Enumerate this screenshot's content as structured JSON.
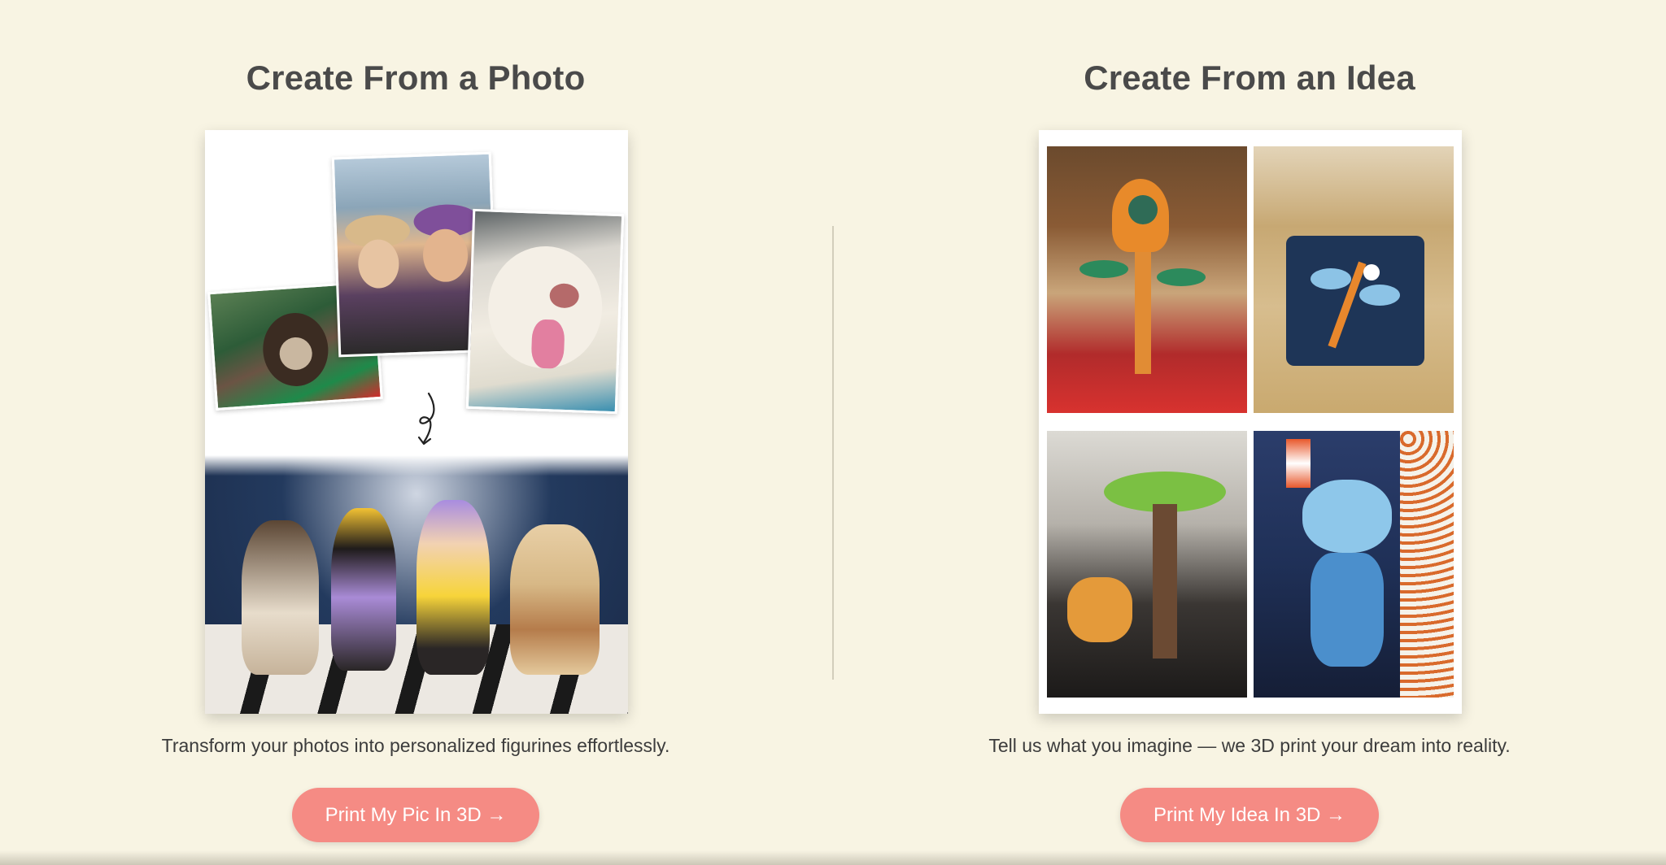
{
  "photo_section": {
    "title": "Create From a Photo",
    "description": "Transform your photos into personalized figurines effortlessly.",
    "cta_label": "Print My Pic In 3D →",
    "collage": {
      "source_photos": [
        "dog-photo",
        "couple-selfie-photo",
        "white-dog-photo"
      ],
      "result_image": "figurines-on-piano-photo",
      "arrow_icon": "curly-arrow-down-icon"
    }
  },
  "idea_section": {
    "title": "Create From an Idea",
    "description": "Tell us what you imagine — we 3D print your dream into reality.",
    "cta_label": "Print My Idea In 3D →",
    "gallery": [
      "frog-on-flower-figurine-photo",
      "blue-leaf-sculpture-photo",
      "tree-and-corgi-figurine-photo",
      "astronaut-figurine-photo"
    ]
  },
  "colors": {
    "background": "#f8f4e3",
    "title": "#4a4a4a",
    "body_text": "#3c3c3c",
    "cta_background": "#f58b84",
    "cta_text": "#ffffff",
    "divider": "#d2cdbb"
  }
}
